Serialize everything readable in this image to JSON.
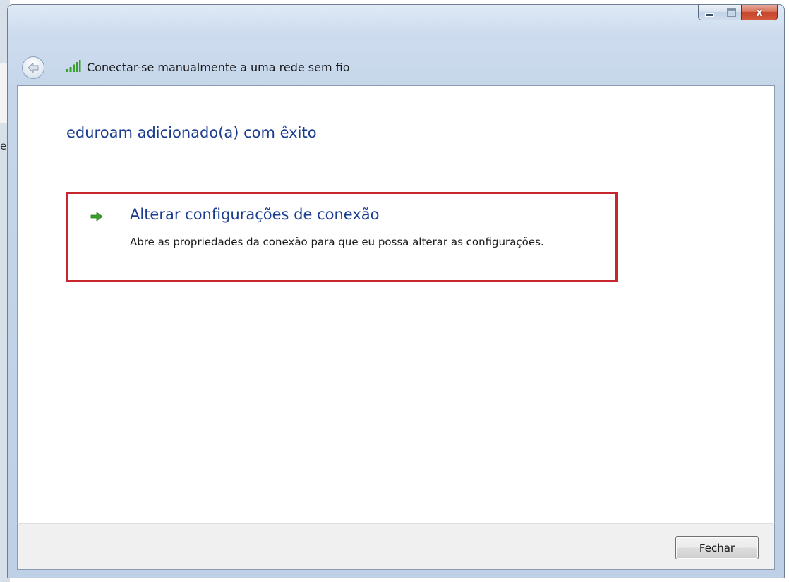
{
  "window": {
    "title": "Conectar-se manualmente a uma rede sem fio",
    "close_glyph": "x"
  },
  "content": {
    "heading": "eduroam adicionado(a) com êxito",
    "option": {
      "title": "Alterar configurações de conexão",
      "description": "Abre as propriedades da conexão para que eu possa alterar as configurações."
    }
  },
  "footer": {
    "close_label": "Fechar"
  },
  "background": {
    "partial_char": "e"
  },
  "colors": {
    "heading": "#1a3d8f",
    "highlight_border": "#c8262f",
    "arrow": "#3aa02c",
    "signal": "#3aa02c"
  },
  "icons": {
    "back": "back-arrow-icon",
    "signal": "wireless-signal-icon",
    "option_arrow": "green-arrow-icon"
  }
}
